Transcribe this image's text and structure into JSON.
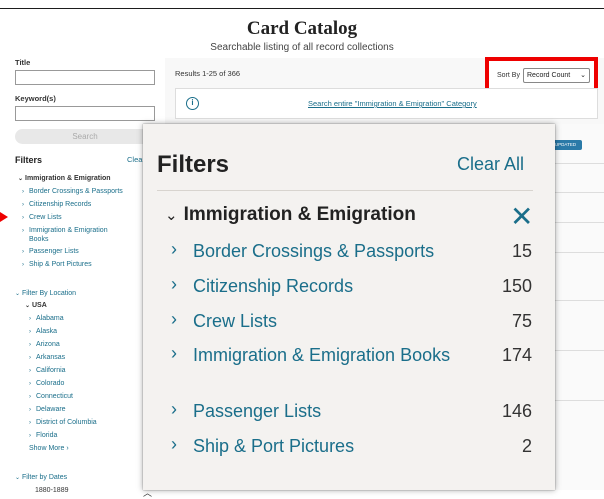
{
  "page": {
    "title": "Card Catalog",
    "subtitle": "Searchable listing of all record collections"
  },
  "sidebar": {
    "title_label": "Title",
    "keywords_label": "Keyword(s)",
    "search_button": "Search",
    "filters_heading": "Filters",
    "clear_label": "Clea",
    "category": "Immigration & Emigration",
    "category_items": [
      "Border Crossings & Passports",
      "Citizenship Records",
      "Crew Lists",
      "Immigration & Emigration",
      "Books",
      "Passenger Lists",
      "Ship & Port Pictures"
    ],
    "location_heading": "Filter By Location",
    "country": "USA",
    "states": [
      "Alabama",
      "Alaska",
      "Arizona",
      "Arkansas",
      "California",
      "Colorado",
      "Connecticut",
      "Delaware",
      "District of Columbia",
      "Florida"
    ],
    "show_more": "Show More",
    "dates_heading": "Filter by Dates",
    "date_range": "1880-1889"
  },
  "results": {
    "count_text": "Results 1-25 of 366",
    "sort_label": "Sort By",
    "sort_value": "Record Count",
    "info_link": "Search entire \"Immigration & Emigration\" Category",
    "updated_badge": "UPDATED"
  },
  "overlay": {
    "heading": "Filters",
    "clear_all": "Clear All",
    "category": "Immigration & Emigration",
    "items": [
      {
        "label": "Border Crossings & Passports",
        "count": "15"
      },
      {
        "label": "Citizenship Records",
        "count": "150"
      },
      {
        "label": "Crew Lists",
        "count": "75"
      },
      {
        "label": "Immigration & Emigration Books",
        "count": "174"
      },
      {
        "label": "Passenger Lists",
        "count": "146"
      },
      {
        "label": "Ship & Port Pictures",
        "count": "2"
      }
    ]
  },
  "colors": {
    "link": "#1a6e8a",
    "highlight": "#e00000",
    "overlay_bg": "#f4f2f0"
  }
}
